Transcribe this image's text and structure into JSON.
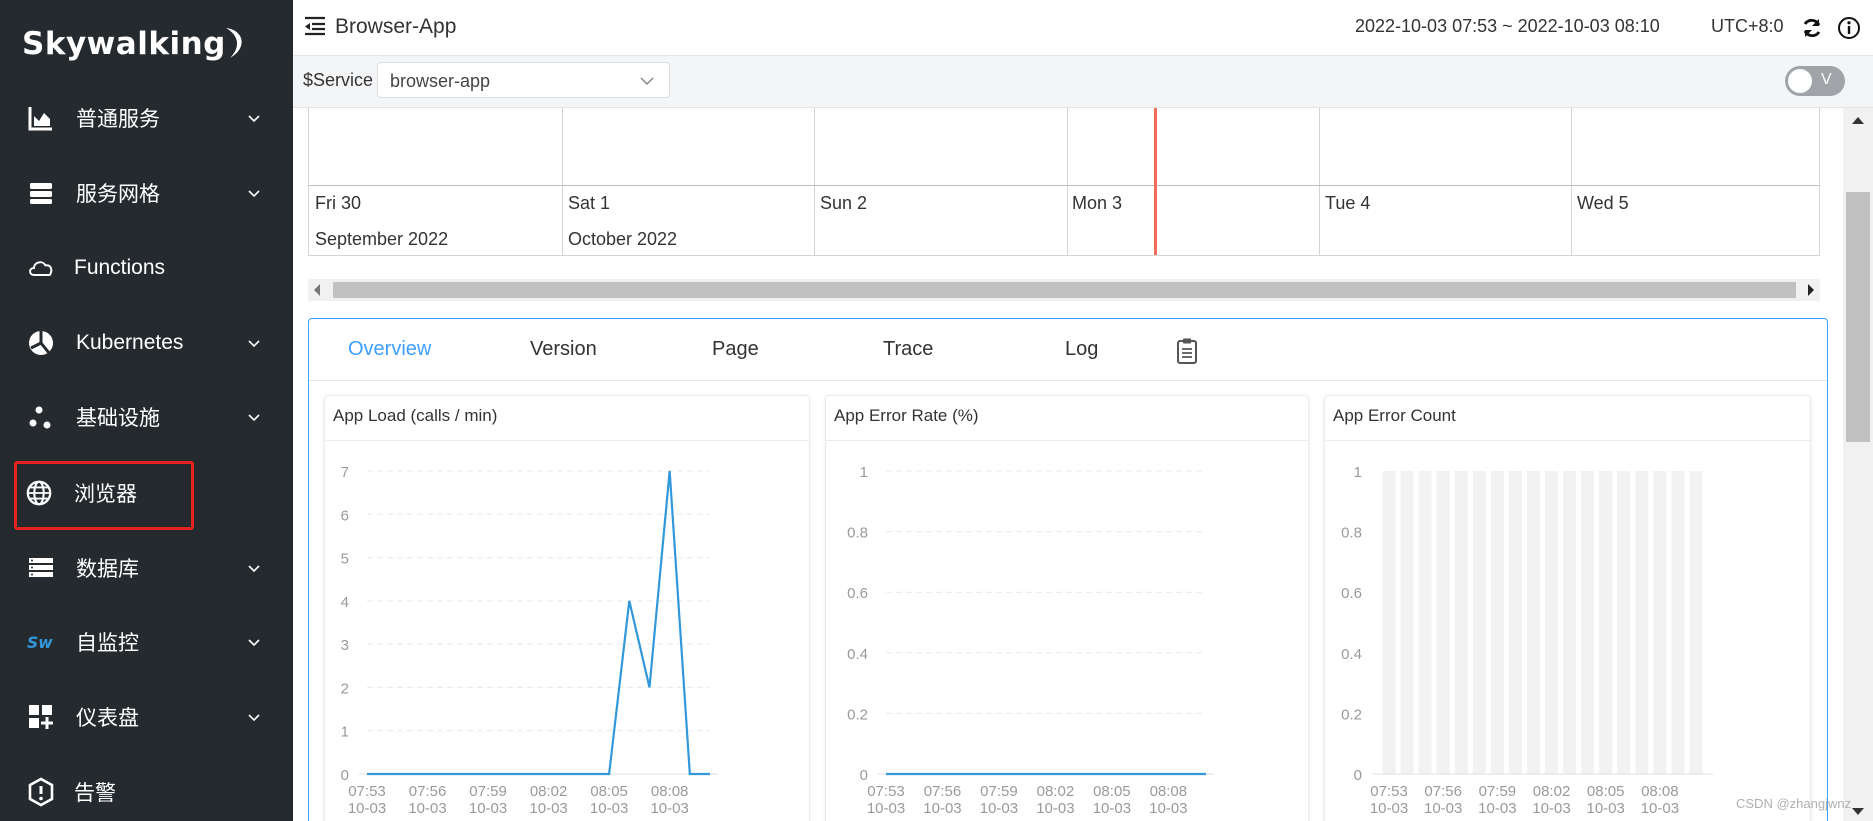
{
  "sidebar": {
    "logo_text": "Skywalking",
    "items": [
      {
        "label": "普通服务",
        "icon": "line-chart-icon",
        "has_chevron": true
      },
      {
        "label": "服务网格",
        "icon": "server-stack-icon",
        "has_chevron": true
      },
      {
        "label": "Functions",
        "icon": "cloud-icon",
        "has_chevron": false
      },
      {
        "label": "Kubernetes",
        "icon": "kubernetes-icon",
        "has_chevron": true
      },
      {
        "label": "基础设施",
        "icon": "dots-icon",
        "has_chevron": true
      },
      {
        "label": "浏览器",
        "icon": "globe-icon",
        "has_chevron": false,
        "highlighted": true
      },
      {
        "label": "数据库",
        "icon": "database-icon",
        "has_chevron": true
      },
      {
        "label": "自监控",
        "icon": "sw-logo-icon",
        "has_chevron": true
      },
      {
        "label": "仪表盘",
        "icon": "dashboard-icon",
        "has_chevron": true
      },
      {
        "label": "告警",
        "icon": "alarm-icon",
        "has_chevron": false
      }
    ]
  },
  "header": {
    "title": "Browser-App",
    "time_range": "2022-10-03 07:53 ~ 2022-10-03 08:10",
    "timezone": "UTC+8:0"
  },
  "toolbar": {
    "service_label": "$Service",
    "service_value": "browser-app",
    "toggle_label": "V"
  },
  "timeline": {
    "days": [
      "Fri 30",
      "Sat 1",
      "Sun 2",
      "Mon 3",
      "Tue 4",
      "Wed 5"
    ],
    "months": [
      "September 2022",
      "October 2022"
    ]
  },
  "tabs": [
    {
      "label": "Overview",
      "active": true
    },
    {
      "label": "Version",
      "active": false
    },
    {
      "label": "Page",
      "active": false
    },
    {
      "label": "Trace",
      "active": false
    },
    {
      "label": "Log",
      "active": false
    }
  ],
  "colors": {
    "sidebar_bg": "#252a2f",
    "accent": "#409eff",
    "series": "#3398db",
    "highlight": "#e8231f",
    "now_line": "#f26d5a"
  },
  "chart_data": [
    {
      "type": "line",
      "title": "App Load (calls / min)",
      "x": [
        "07:53\n10-03",
        "07:54\n10-03",
        "07:55\n10-03",
        "07:56\n10-03",
        "07:57\n10-03",
        "07:58\n10-03",
        "07:59\n10-03",
        "08:00\n10-03",
        "08:01\n10-03",
        "08:02\n10-03",
        "08:03\n10-03",
        "08:04\n10-03",
        "08:05\n10-03",
        "08:06\n10-03",
        "08:07\n10-03",
        "08:08\n10-03",
        "08:09\n10-03",
        "08:10\n10-03"
      ],
      "x_tick_labels": [
        [
          "07:53",
          "10-03"
        ],
        [
          "07:56",
          "10-03"
        ],
        [
          "07:59",
          "10-03"
        ],
        [
          "08:02",
          "10-03"
        ],
        [
          "08:05",
          "10-03"
        ],
        [
          "08:08",
          "10-03"
        ]
      ],
      "values": [
        0,
        0,
        0,
        0,
        0,
        0,
        0,
        0,
        0,
        0,
        0,
        0,
        0,
        4,
        2,
        7,
        0,
        0
      ],
      "y_ticks": [
        "0",
        "1",
        "2",
        "3",
        "4",
        "5",
        "6",
        "7"
      ],
      "ylim": [
        0,
        7
      ],
      "grid": true
    },
    {
      "type": "line",
      "title": "App Error Rate (%)",
      "x": [
        "07:53\n10-03",
        "07:54\n10-03",
        "07:55\n10-03",
        "07:56\n10-03",
        "07:57\n10-03",
        "07:58\n10-03",
        "07:59\n10-03",
        "08:00\n10-03",
        "08:01\n10-03",
        "08:02\n10-03",
        "08:03\n10-03",
        "08:04\n10-03",
        "08:05\n10-03",
        "08:06\n10-03",
        "08:07\n10-03",
        "08:08\n10-03",
        "08:09\n10-03",
        "08:10\n10-03"
      ],
      "x_tick_labels": [
        [
          "07:53",
          "10-03"
        ],
        [
          "07:56",
          "10-03"
        ],
        [
          "07:59",
          "10-03"
        ],
        [
          "08:02",
          "10-03"
        ],
        [
          "08:05",
          "10-03"
        ],
        [
          "08:08",
          "10-03"
        ]
      ],
      "values": [
        0,
        0,
        0,
        0,
        0,
        0,
        0,
        0,
        0,
        0,
        0,
        0,
        0,
        0,
        0,
        0,
        0,
        0
      ],
      "y_ticks": [
        "0",
        "0.2",
        "0.4",
        "0.6",
        "0.8",
        "1"
      ],
      "ylim": [
        0,
        1
      ],
      "grid": true
    },
    {
      "type": "bar",
      "title": "App Error Count",
      "x": [
        "07:53\n10-03",
        "07:54\n10-03",
        "07:55\n10-03",
        "07:56\n10-03",
        "07:57\n10-03",
        "07:58\n10-03",
        "07:59\n10-03",
        "08:00\n10-03",
        "08:01\n10-03",
        "08:02\n10-03",
        "08:03\n10-03",
        "08:04\n10-03",
        "08:05\n10-03",
        "08:06\n10-03",
        "08:07\n10-03",
        "08:08\n10-03",
        "08:09\n10-03",
        "08:10\n10-03"
      ],
      "x_tick_labels": [
        [
          "07:53",
          "10-03"
        ],
        [
          "07:56",
          "10-03"
        ],
        [
          "07:59",
          "10-03"
        ],
        [
          "08:02",
          "10-03"
        ],
        [
          "08:05",
          "10-03"
        ],
        [
          "08:08",
          "10-03"
        ]
      ],
      "values": [
        0,
        0,
        0,
        0,
        0,
        0,
        0,
        0,
        0,
        0,
        0,
        0,
        0,
        0,
        0,
        0,
        0,
        0
      ],
      "y_ticks": [
        "0",
        "0.2",
        "0.4",
        "0.6",
        "0.8",
        "1"
      ],
      "ylim": [
        0,
        1
      ],
      "grid": false
    }
  ],
  "watermark": "CSDN @zhangjwnz"
}
